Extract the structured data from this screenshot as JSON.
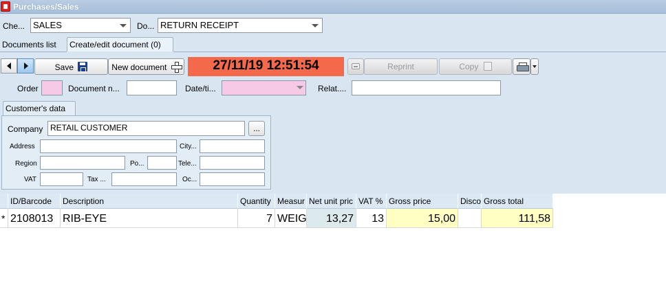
{
  "window": {
    "title": "Purchases/Sales"
  },
  "filters": {
    "checkout_label": "Che...",
    "checkout_value": "SALES",
    "document_label": "Do...",
    "document_value": "RETURN RECEIPT"
  },
  "tabs": [
    {
      "label": "Documents list"
    },
    {
      "label": "Create/edit document (0)"
    }
  ],
  "toolbar": {
    "save_label": "Save",
    "new_document_label": "New document",
    "datetime": "27/11/19 12:51:54",
    "reprint_label": "Reprint",
    "copy_label": "Copy"
  },
  "header_fields": {
    "order_label": "Order",
    "document_number_label": "Document n...",
    "datetime_label": "Date/ti...",
    "related_label": "Relat...."
  },
  "customer": {
    "tab_label": "Customer's data",
    "company_label": "Company",
    "company_value": "RETAIL CUSTOMER",
    "browse_label": "...",
    "address_label": "Address",
    "city_label": "City...",
    "region_label": "Region",
    "postal_label": "Po...",
    "telephone_label": "Tele...",
    "vat_label": "VAT",
    "tax_label": "Tax ...",
    "occupation_label": "Oc..."
  },
  "grid": {
    "columns": [
      "ID/Barcode",
      "Description",
      "Quantity",
      "Measur",
      "Net unit pric",
      "VAT %",
      "Gross price",
      "Disco",
      "Gross total"
    ],
    "rows": [
      {
        "marker": "*",
        "id": "2108013",
        "description": "RIB-EYE",
        "quantity": "7",
        "measure": "WEIG",
        "net_unit_price": "13,27",
        "vat": "13",
        "gross_price": "15,00",
        "discount": "",
        "gross_total": "111,58"
      }
    ]
  },
  "colors": {
    "datetime_background": "#f4694a",
    "highlight_yellow": "#ffffc4",
    "required_pink": "#f6c9e6"
  }
}
